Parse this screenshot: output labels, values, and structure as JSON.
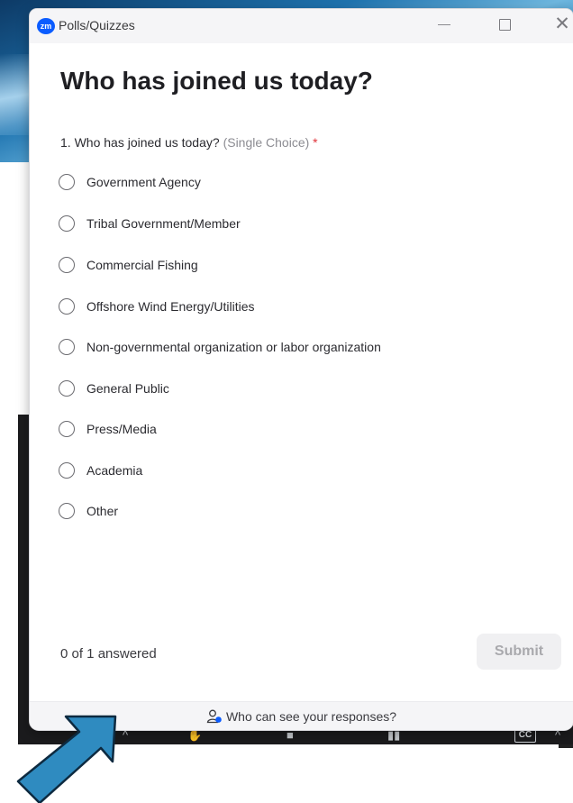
{
  "window": {
    "logo_text": "zm",
    "title": "Polls/Quizzes",
    "close_glyph": "✕"
  },
  "poll": {
    "heading": "Who has joined us today?",
    "question": {
      "number_text": "1. Who has joined us today?",
      "type": "(Single Choice)",
      "required_mark": "*"
    },
    "options": [
      "Government Agency",
      "Tribal Government/Member",
      "Commercial Fishing",
      "Offshore Wind Energy/Utilities",
      "Non-governmental organization or labor organization",
      "General Public",
      "Press/Media",
      "Academia",
      "Other"
    ],
    "progress_text": "0 of 1 answered",
    "submit_label": "Submit",
    "visibility_text": "Who can see your responses?"
  },
  "taskbar": {
    "chevron": "^",
    "cc_label": "CC"
  },
  "colors": {
    "accent": "#0b5cff",
    "required": "#e0333a",
    "arrow": "#2f8bc0"
  }
}
